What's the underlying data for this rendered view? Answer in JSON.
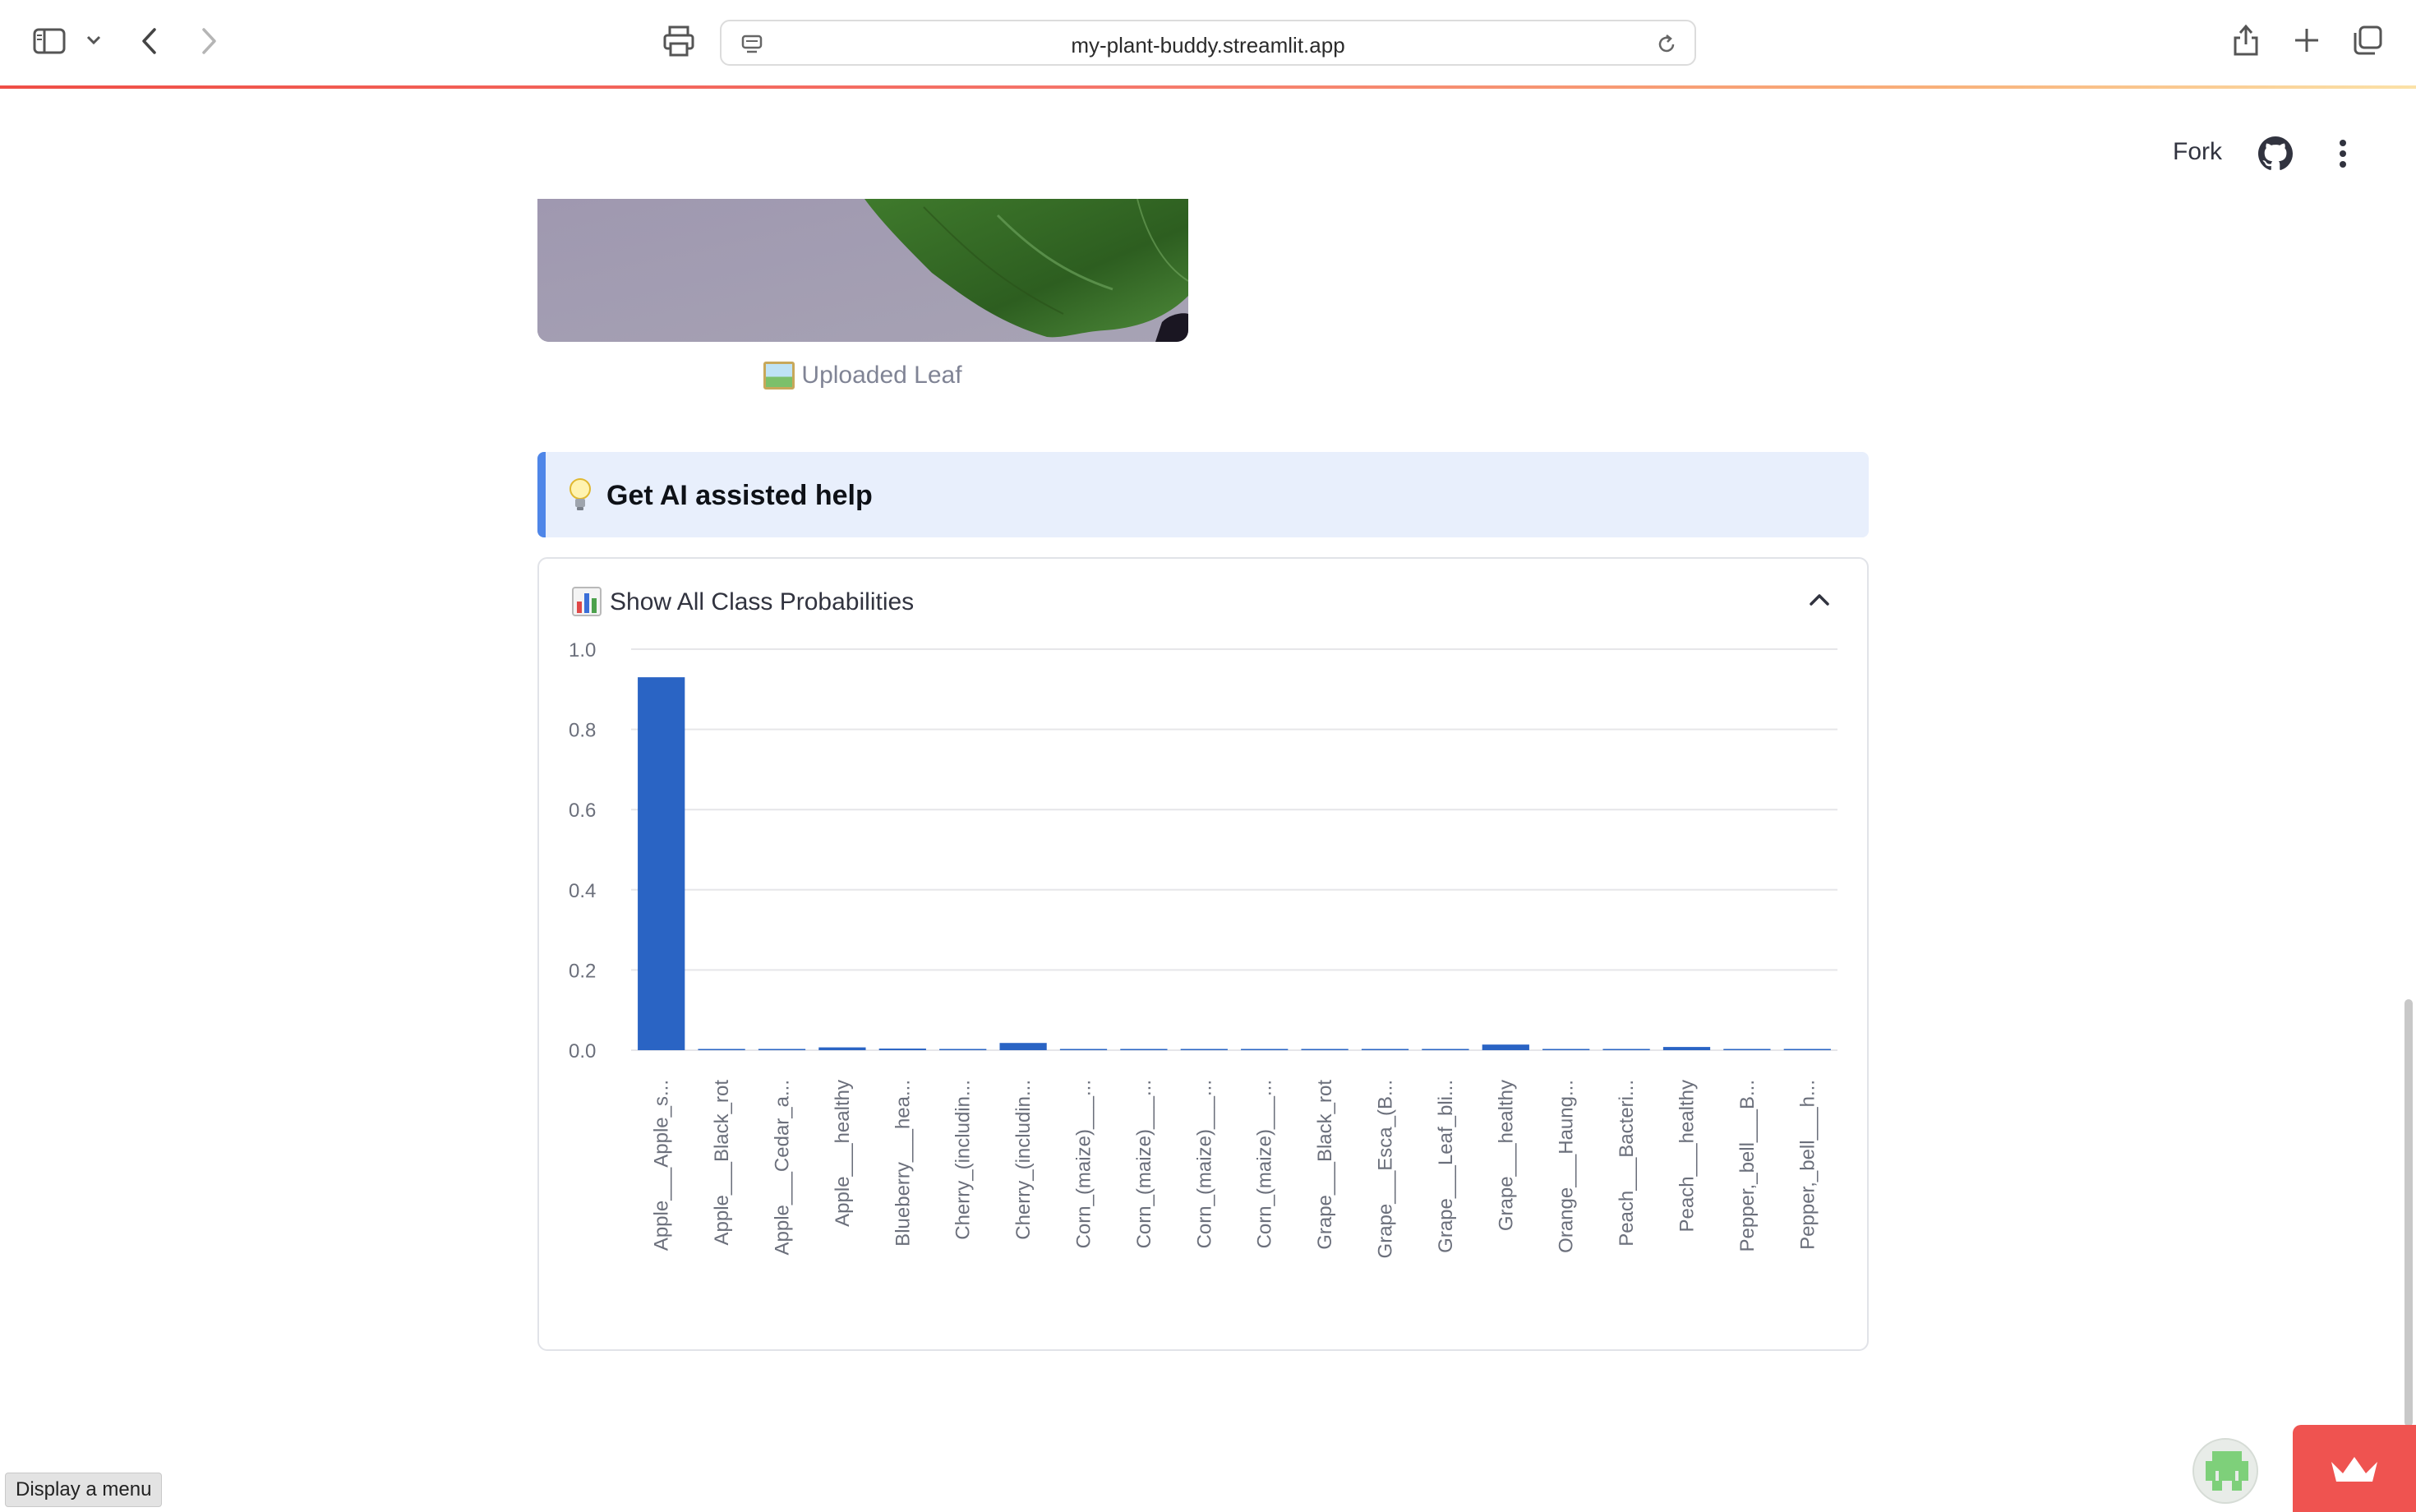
{
  "browser": {
    "url": "my-plant-buddy.streamlit.app",
    "icons": [
      "sidebar-icon",
      "chevron-down-icon",
      "back-icon",
      "forward-icon",
      "print-icon",
      "site-settings-icon",
      "reload-icon",
      "share-icon",
      "new-tab-icon",
      "tab-overview-icon"
    ]
  },
  "header": {
    "fork_label": "Fork",
    "icons": [
      "github-icon",
      "more-vert-icon"
    ]
  },
  "image_caption": "Uploaded Leaf",
  "ai_help": {
    "label": "Get AI assisted help",
    "icon": "lightbulb-icon"
  },
  "expander": {
    "label": "Show All Class Probabilities",
    "icon": "bar-chart-icon",
    "state": "expanded"
  },
  "chart_data": {
    "type": "bar",
    "categories": [
      "Apple___Apple_s...",
      "Apple___Black_rot",
      "Apple___Cedar_a...",
      "Apple___healthy",
      "Blueberry___hea...",
      "Cherry_(includin...",
      "Cherry_(includin...",
      "Corn_(maize)___...",
      "Corn_(maize)___...",
      "Corn_(maize)___...",
      "Corn_(maize)___...",
      "Grape___Black_rot",
      "Grape___Esca_(B...",
      "Grape___Leaf_bli...",
      "Grape___healthy",
      "Orange___Haung...",
      "Peach___Bacteri...",
      "Peach___healthy",
      "Pepper,_bell___B...",
      "Pepper,_bell___h..."
    ],
    "values": [
      0.93,
      0.001,
      0.003,
      0.007,
      0.004,
      0.003,
      0.018,
      0.001,
      0.0,
      0.002,
      0.003,
      0.001,
      0.0,
      0.001,
      0.014,
      0.0,
      0.003,
      0.008,
      0.002,
      0.001
    ],
    "yticks": [
      "0.0",
      "0.2",
      "0.4",
      "0.6",
      "0.8",
      "1.0"
    ],
    "ylim": [
      0,
      1.0
    ],
    "bar_color": "#2a64c4",
    "grid": true
  },
  "tooltip": "Display a menu",
  "colors": {
    "accent": "#ef5350",
    "info_bg": "#e8effc",
    "info_bar": "#4f86e8"
  }
}
